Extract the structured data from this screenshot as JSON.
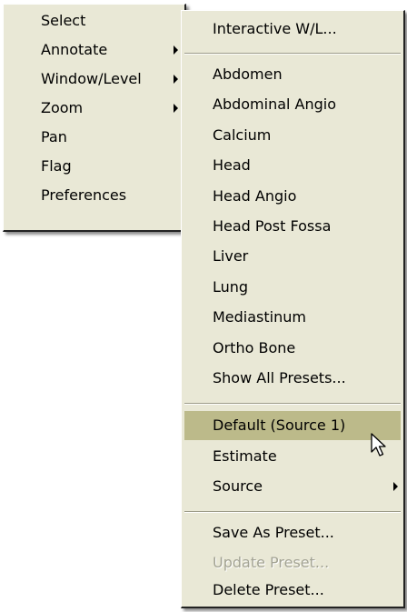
{
  "main_menu": {
    "items": [
      {
        "label": "Select"
      },
      {
        "label": "Annotate"
      },
      {
        "label": "Window/Level"
      },
      {
        "label": "Zoom"
      },
      {
        "label": "Pan"
      },
      {
        "label": "Flag"
      },
      {
        "label": "Preferences"
      }
    ]
  },
  "submenu": {
    "interactive": "Interactive W/L...",
    "presets": [
      "Abdomen",
      "Abdominal Angio",
      "Calcium",
      "Head",
      "Head Angio",
      "Head Post Fossa",
      "Liver",
      "Lung",
      "Mediastinum",
      "Ortho Bone",
      "Show All Presets..."
    ],
    "sources": [
      "Default (Source 1)",
      "Estimate",
      "Source"
    ],
    "actions": [
      "Save As Preset...",
      "Update Preset...",
      "Delete Preset..."
    ]
  },
  "colors": {
    "menu_background": "#e9e8d6",
    "highlight": "#bcba8a",
    "disabled_text": "#a3a394"
  }
}
